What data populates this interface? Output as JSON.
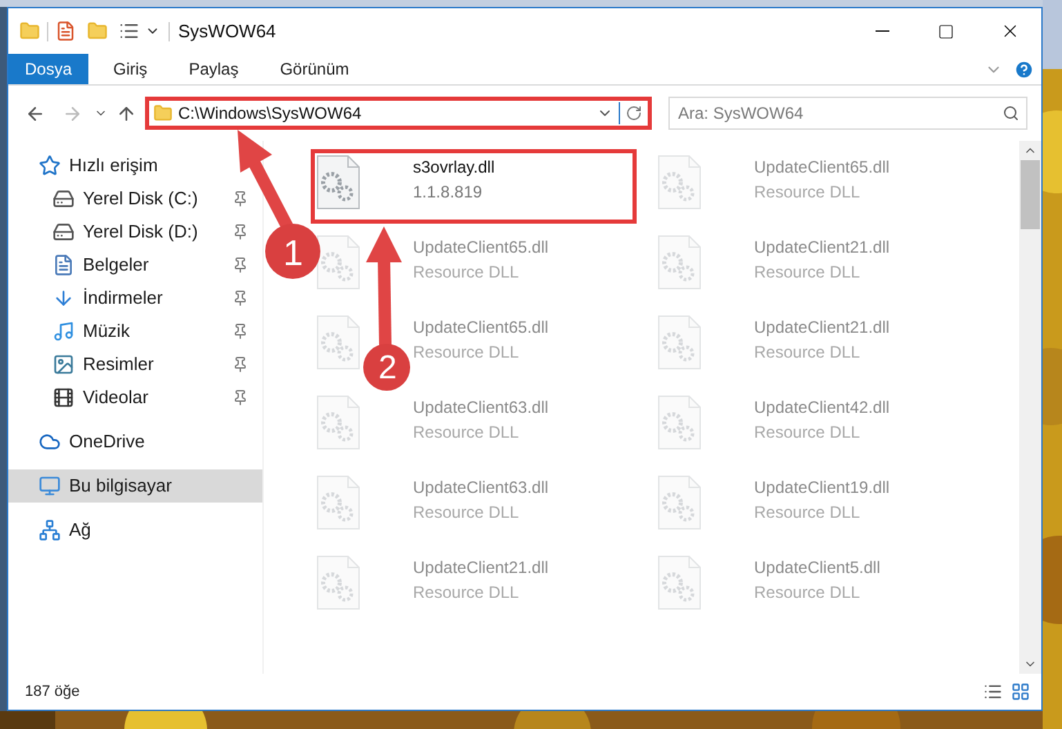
{
  "window": {
    "title": "SysWOW64"
  },
  "ribbon_tabs": [
    {
      "label": "Dosya",
      "selected": true
    },
    {
      "label": "Giriş",
      "selected": false
    },
    {
      "label": "Paylaş",
      "selected": false
    },
    {
      "label": "Görünüm",
      "selected": false
    }
  ],
  "address_bar": {
    "path": "C:\\Windows\\SysWOW64"
  },
  "search": {
    "placeholder": "Ara: SysWOW64"
  },
  "sidebar": {
    "items": [
      {
        "label": "Hızlı erişim",
        "selected": false,
        "children": [
          {
            "label": "Yerel Disk (C:)",
            "pinned": true,
            "selected": false
          },
          {
            "label": "Yerel Disk (D:)",
            "pinned": true,
            "selected": false
          },
          {
            "label": "Belgeler",
            "pinned": true,
            "selected": false
          },
          {
            "label": "İndirmeler",
            "pinned": true,
            "selected": false
          },
          {
            "label": "Müzik",
            "pinned": true,
            "selected": false
          },
          {
            "label": "Resimler",
            "pinned": true,
            "selected": false
          },
          {
            "label": "Videolar",
            "pinned": true,
            "selected": false
          }
        ]
      },
      {
        "label": "OneDrive",
        "selected": false
      },
      {
        "label": "Bu bilgisayar",
        "selected": true
      },
      {
        "label": "Ağ",
        "selected": false
      }
    ]
  },
  "files": [
    {
      "name": "s3ovrlay.dll",
      "detail": "1.1.8.819",
      "highlighted": true
    },
    {
      "name": "UpdateClient65.dll",
      "detail": "Resource DLL",
      "highlighted": false
    },
    {
      "name": "UpdateClient65.dll",
      "detail": "Resource DLL",
      "highlighted": false
    },
    {
      "name": "UpdateClient21.dll",
      "detail": "Resource DLL",
      "highlighted": false
    },
    {
      "name": "UpdateClient65.dll",
      "detail": "Resource DLL",
      "highlighted": false
    },
    {
      "name": "UpdateClient21.dll",
      "detail": "Resource DLL",
      "highlighted": false
    },
    {
      "name": "UpdateClient63.dll",
      "detail": "Resource DLL",
      "highlighted": false
    },
    {
      "name": "UpdateClient42.dll",
      "detail": "Resource DLL",
      "highlighted": false
    },
    {
      "name": "UpdateClient63.dll",
      "detail": "Resource DLL",
      "highlighted": false
    },
    {
      "name": "UpdateClient19.dll",
      "detail": "Resource DLL",
      "highlighted": false
    },
    {
      "name": "UpdateClient21.dll",
      "detail": "Resource DLL",
      "highlighted": false
    },
    {
      "name": "UpdateClient5.dll",
      "detail": "Resource DLL",
      "highlighted": false
    }
  ],
  "status_bar": {
    "item_count": "187 öğe"
  },
  "annotations": [
    {
      "label": "1"
    },
    {
      "label": "2"
    }
  ]
}
